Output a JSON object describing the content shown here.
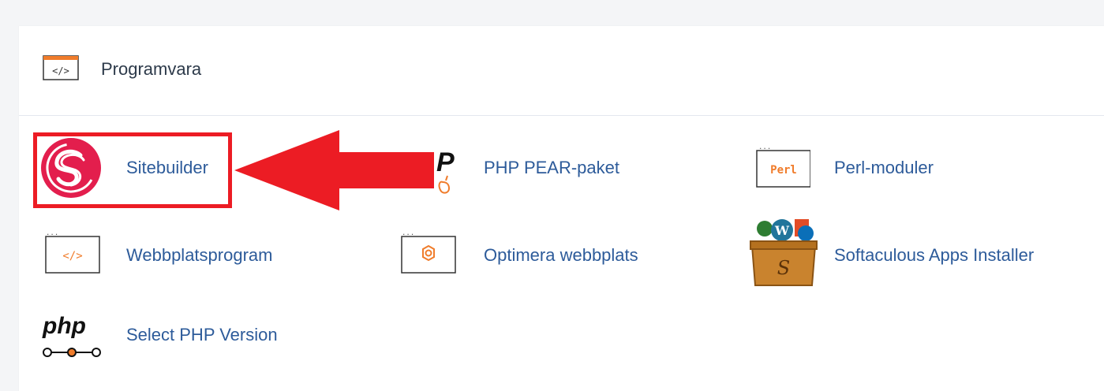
{
  "section": {
    "title": "Programvara",
    "icon": "code-window-icon"
  },
  "items": [
    {
      "label": "Sitebuilder",
      "icon": "sitebuilder-logo-icon"
    },
    {
      "label": "PHP PEAR-paket",
      "icon": "php-pear-icon"
    },
    {
      "label": "Perl-moduler",
      "icon": "perl-icon",
      "icon_text": "Perl"
    },
    {
      "label": "Webbplatsprogram",
      "icon": "code-window-icon"
    },
    {
      "label": "Optimera webbplats",
      "icon": "optimize-gear-icon"
    },
    {
      "label": "Softaculous Apps Installer",
      "icon": "softaculous-box-icon"
    },
    {
      "label": "Select PHP Version",
      "icon": "php-version-icon"
    }
  ],
  "annotation": {
    "highlight_color": "#ec1c24",
    "target": "Sitebuilder"
  },
  "colors": {
    "link": "#2d5b9a",
    "accent_orange": "#f07c2b",
    "sitebuilder_red": "#e31e4d"
  }
}
